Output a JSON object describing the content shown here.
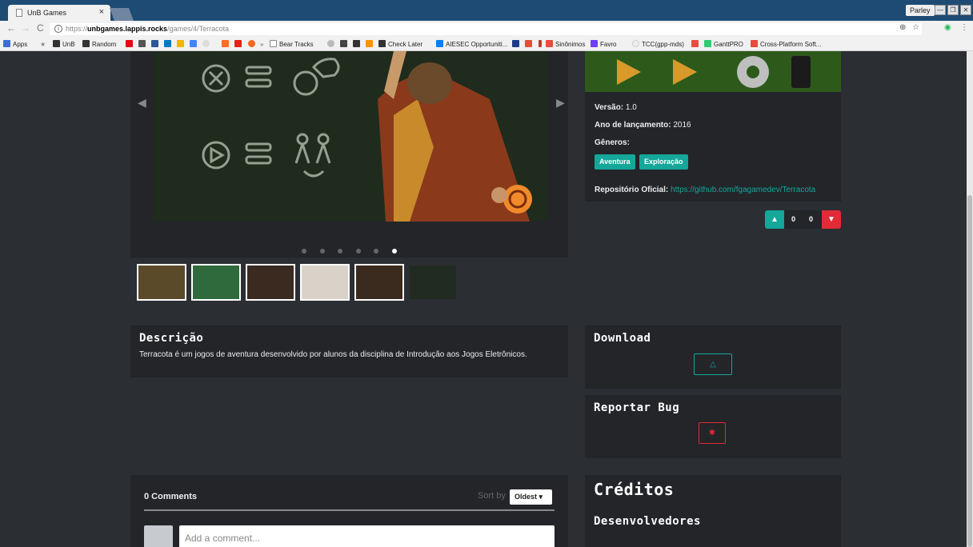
{
  "browser": {
    "tab_title": "UnB Games",
    "tab_close": "×",
    "profile_name": "Parley",
    "win_min": "—",
    "win_restore": "❐",
    "win_close": "✕",
    "url_protocol": "https://",
    "url_host": "unbgames.lappis.rocks",
    "url_path": "/games/4/Terracota",
    "nav_back": "←",
    "nav_forward": "→",
    "nav_reload": "C",
    "info_icon": "i",
    "zoom_icon": "⊕",
    "star_icon": "☆",
    "ext_icon": "◉",
    "menu_icon": "⋮"
  },
  "bookmarks": {
    "apps": "Apps",
    "unb": "UnB",
    "random": "Random",
    "bear_tracks": "Bear Tracks",
    "check_later": "Check Later",
    "aiesec": "AIESEC Opportuniti...",
    "sinonimos": "Sinônimos",
    "favro": "Favro",
    "tcc": "TCC(gpp-mds)",
    "ganttpro": "GanttPRO",
    "crossplatform": "Cross-Platform Soft..."
  },
  "carousel": {
    "prev_label": "◀",
    "next_label": "▶",
    "slide_count": 6,
    "active_slide": 6,
    "thumbs": 6
  },
  "game_info": {
    "version_label": "Versão:",
    "version_value": "1.0",
    "year_label": "Ano de lançamento:",
    "year_value": "2016",
    "genres_label": "Gêneros:",
    "genres": [
      "Aventura",
      "Exploração"
    ],
    "repo_label": "Repositório Oficial:",
    "repo_url": "https://github.com/fgagamedev/Terracota"
  },
  "votes": {
    "up_count": "0",
    "down_count": "0"
  },
  "description": {
    "title": "Descrição",
    "text": "Terracota é um jogos de aventura desenvolvido por alunos da disciplina de Introdução aos Jogos Eletrônicos."
  },
  "download": {
    "title": "Download",
    "button_icon": "linux-icon"
  },
  "report_bug": {
    "title": "Reportar Bug",
    "button_icon": "bug-icon"
  },
  "credits": {
    "title": "Créditos",
    "developers_title": "Desenvolvedores"
  },
  "comments": {
    "count_label": "0 Comments",
    "sort_by": "Sort by",
    "sort_value": "Oldest ▾",
    "input_placeholder": "Add a comment..."
  },
  "colors": {
    "accent": "#14a79a",
    "danger": "#e22b36",
    "page_bg": "#2b2e33",
    "panel_bg": "#232529"
  }
}
